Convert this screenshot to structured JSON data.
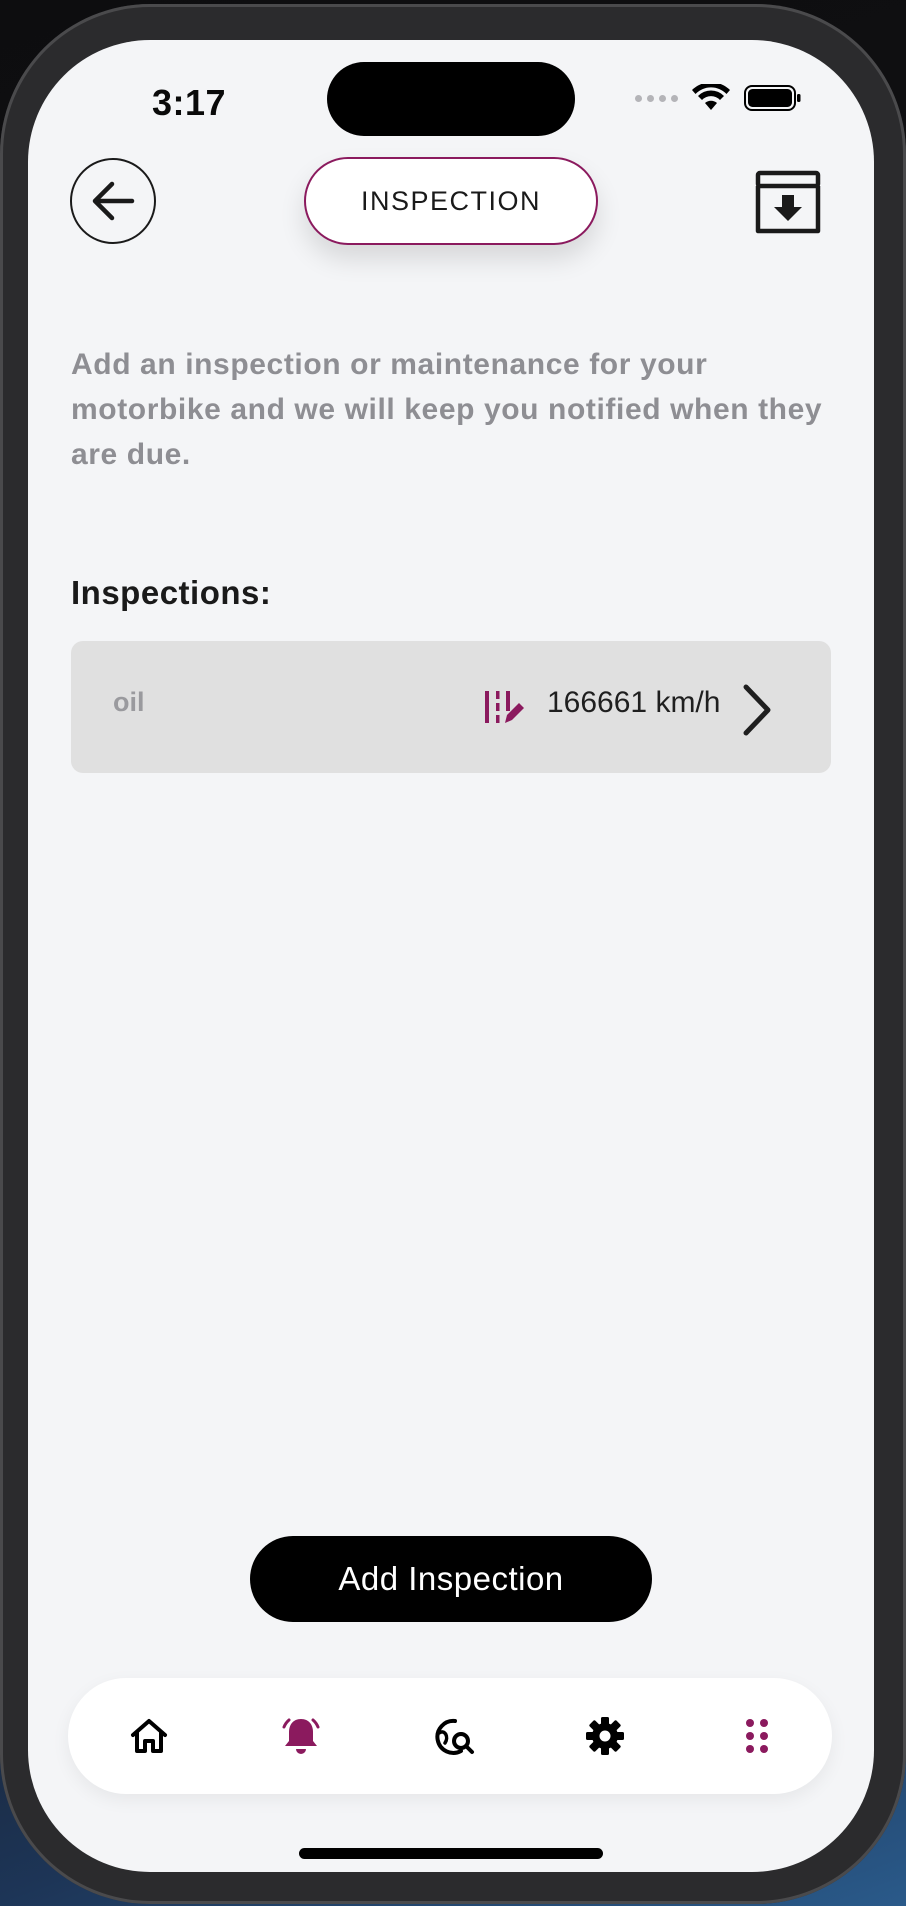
{
  "status_bar": {
    "time": "3:17"
  },
  "header": {
    "title": "INSPECTION",
    "back_icon": "arrow-left-icon",
    "archive_icon": "archive-download-icon"
  },
  "intro": {
    "text": "Add an inspection or maintenance for your motorbike and we will keep you notified when they are due."
  },
  "inspections": {
    "heading": "Inspections:",
    "items": [
      {
        "name": "oil",
        "type_icon": "odometer-edit-icon",
        "value": "166661 km/h"
      }
    ]
  },
  "actions": {
    "add_label": "Add Inspection"
  },
  "bottom_nav": {
    "items": [
      {
        "icon": "home-icon",
        "active": false
      },
      {
        "icon": "bell-icon",
        "active": true
      },
      {
        "icon": "globe-search-icon",
        "active": false
      },
      {
        "icon": "gear-icon",
        "active": false
      },
      {
        "icon": "grid-dots-icon",
        "active": false
      }
    ]
  },
  "colors": {
    "accent": "#8b1a5e",
    "background": "#f4f5f7",
    "row_background": "#e0e0e0",
    "primary_button": "#000000"
  }
}
